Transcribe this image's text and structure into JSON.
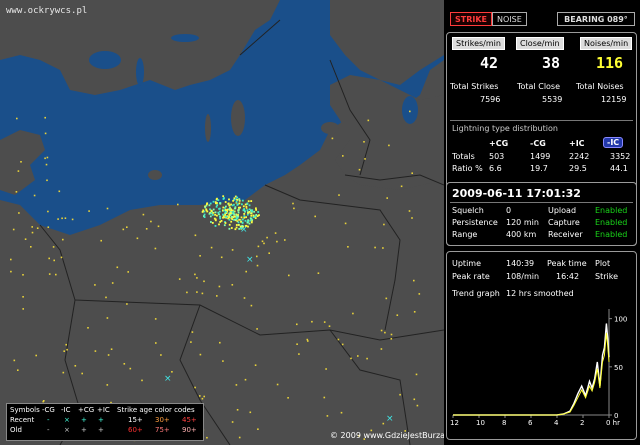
{
  "map": {
    "watermark": "www.ockrywcs.pl",
    "copyright": "© 2009 www.GdzieJestBurza.pl",
    "legend": {
      "row1": [
        "Symbols",
        "-CG",
        "-IC",
        "+CG",
        "+IC",
        "Strike age color codes"
      ],
      "row2": [
        "Recent",
        "-",
        "×",
        "+",
        "+",
        "15+",
        "30+",
        "45+"
      ],
      "row3": [
        "Old",
        "-",
        "×",
        "+",
        "+",
        "60+",
        "75+",
        "90+"
      ],
      "age_colors": [
        "#ffffff",
        "#ff9f40",
        "#ff4040",
        "#ff3030",
        "#ff7a7a",
        "#ffb0b0"
      ]
    }
  },
  "toolbar": {
    "strike": "STRIKE",
    "noise": "NOISE",
    "bearing": "BEARING 089°"
  },
  "rates": {
    "headers": [
      "Strikes/min",
      "Close/min",
      "Noises/min"
    ],
    "values": [
      "42",
      "38",
      "116"
    ],
    "totals_labels": [
      "Total Strikes",
      "Total Close",
      "Total Noises"
    ],
    "totals_values": [
      "7596",
      "5539",
      "12159"
    ]
  },
  "distribution": {
    "title": "Lightning type distribution",
    "columns": [
      "+CG",
      "-CG",
      "+IC",
      "-IC"
    ],
    "totals_label": "Totals",
    "totals": [
      "503",
      "1499",
      "2242",
      "3352"
    ],
    "ratio_label": "Ratio %",
    "ratios": [
      "6.6",
      "19.7",
      "29.5",
      "44.1"
    ]
  },
  "status": {
    "datetime": "2009-06-11 17:01:32",
    "rows": [
      [
        "Squelch",
        "0",
        "Upload",
        "Enabled"
      ],
      [
        "Persistence",
        "120 min",
        "Capture",
        "Enabled"
      ],
      [
        "Range",
        "400 km",
        "Receiver",
        "Enabled"
      ]
    ]
  },
  "stats": {
    "uptime_label": "Uptime",
    "uptime": "140:39",
    "peak_time_label": "Peak time",
    "peak_time": "16:42",
    "peak_rate_label": "Peak rate",
    "peak_rate": "108/min",
    "plot_label": "Plot",
    "plot_value": "Strike",
    "trend_label": "Trend graph",
    "trend_value": "12 hrs smoothed"
  },
  "chart_data": {
    "type": "line",
    "x_ticks": [
      "12",
      "10",
      "8",
      "6",
      "4",
      "2",
      "0 hr"
    ],
    "y_ticks": [
      "100",
      "50",
      "0"
    ],
    "xlim": [
      12,
      0
    ],
    "ylim": [
      0,
      110
    ],
    "series": [
      {
        "color": "#ffffff",
        "x": [
          12,
          11,
          10,
          9,
          8,
          7,
          6,
          5,
          4,
          3.5,
          3,
          2.7,
          2.4,
          2.1,
          1.8,
          1.5,
          1.3,
          1.1,
          0.9,
          0.7,
          0.5,
          0.35,
          0.2,
          0.1,
          0
        ],
        "y": [
          0,
          0,
          0,
          0,
          0,
          0,
          0,
          0,
          0,
          1,
          4,
          12,
          22,
          30,
          20,
          35,
          28,
          38,
          55,
          30,
          62,
          70,
          95,
          80,
          60
        ]
      },
      {
        "color": "#ffff33",
        "x": [
          12,
          11,
          10,
          9,
          8,
          7,
          6,
          5,
          4,
          3.5,
          3,
          2.7,
          2.4,
          2.1,
          1.8,
          1.5,
          1.3,
          1.1,
          0.9,
          0.7,
          0.5,
          0.35,
          0.2,
          0.1,
          0
        ],
        "y": [
          0,
          0,
          0,
          0,
          0,
          0,
          0,
          0,
          0,
          1,
          3,
          10,
          18,
          26,
          18,
          30,
          25,
          34,
          48,
          28,
          55,
          62,
          85,
          72,
          55
        ]
      }
    ]
  }
}
